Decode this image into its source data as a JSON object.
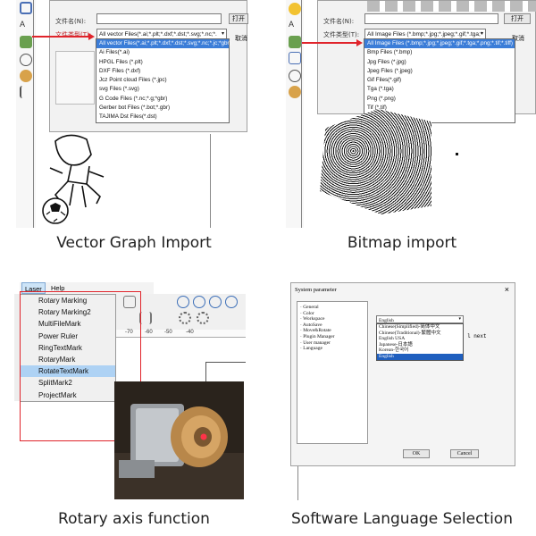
{
  "captions": {
    "vector": "Vector Graph Import",
    "bitmap": "Bitmap import",
    "rotary": "Rotary axis function",
    "language": "Software Language Selection"
  },
  "vector_dialog": {
    "filename_label": "文件名(N):",
    "filetype_label": "文件类型(T):",
    "filetype_value": "All vector Files(*.ai;*.plt;*.dxf;*.dst;*.svg;*.nc;*.",
    "open_button": "打开",
    "cancel_button": "取消",
    "options": [
      "All vector Files(*.ai;*.plt;*.dxf;*.dst;*.svg;*.nc;*.jc;*gbr)",
      "Ai Files(*.ai)",
      "HPGL Files (*.plt)",
      "DXF Files (*.dxf)",
      "Jcz Point cloud Files (*.jpc)",
      "svg Files (*.svg)",
      "G Code Files (*.nc;*.g;*gbr)",
      "Gerber bot Files (*.bot;*.gbr)",
      "TAJIMA Dst Files(*.dst)"
    ],
    "selected_index": 0
  },
  "bitmap_dialog": {
    "filename_label": "文件名(N):",
    "filetype_label": "文件类型(T):",
    "filetype_value": "All Image Files (*.bmp;*.jpg;*.jpeg;*.gif;*.tga;*",
    "open_button": "打开",
    "cancel_button": "取消",
    "options": [
      "All Image Files (*.bmp;*.jpg;*.jpeg;*.gif;*.tga;*.png;*.tif;*.tiff)",
      "Bmp Files (*.bmp)",
      "Jpg Files (*.jpg)",
      "Jpeg Files (*.jpeg)",
      "Gif Files(*.gif)",
      "Tga (*.tga)",
      "Png (*.png)",
      "Tif (*.tif)",
      "Tiff (*.tiff)"
    ],
    "selected_index": 0
  },
  "laser_menu": {
    "menubar": [
      "Laser",
      "Help"
    ],
    "items": [
      "Rotary Marking",
      "Rotary Marking2",
      "MultiFileMark",
      "Power Ruler",
      "RingTextMark",
      "RotaryMark",
      "RotateTextMark",
      "SplitMark2",
      "ProjectMark"
    ],
    "highlighted_index": 6,
    "ruler_labels": [
      "-70",
      "-60",
      "-50",
      "-40"
    ]
  },
  "system_parameter": {
    "title": "System parameter",
    "close": "×",
    "tree": [
      "General",
      "Color",
      "Workspace",
      "AutoSave",
      "Move&Rotate",
      "Plugin Manager",
      "User manager",
      "Language"
    ],
    "language_value": "English",
    "language_options": [
      "Chinese(Simplified)-简体中文",
      "Chinese(Traditional)-繁體中文",
      "English USA",
      "Japanese-日本語",
      "Korean-한국어",
      "English"
    ],
    "selected_language_index": 5,
    "side_text": "l next",
    "ok_button": "OK",
    "cancel_button": "Cancel"
  },
  "colors": {
    "highlight_red": "#e0242b",
    "menu_highlight": "#aed2f4",
    "list_select": "#3b7dd8"
  }
}
